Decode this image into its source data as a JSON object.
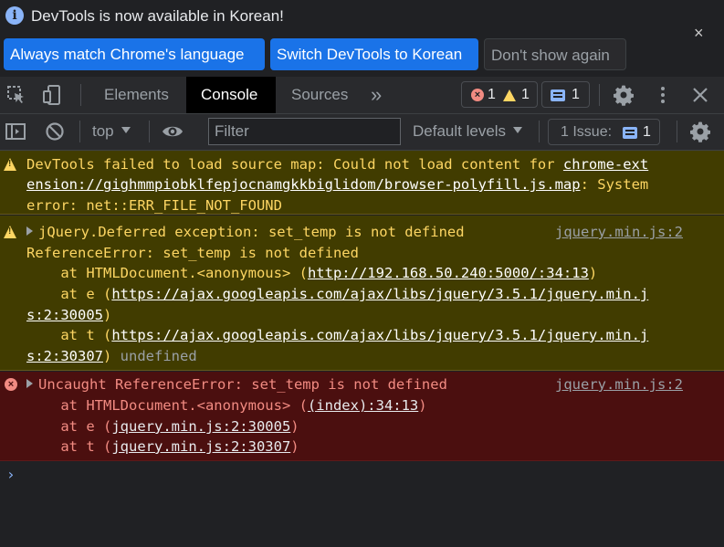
{
  "infobar": {
    "message": "DevTools is now available in Korean!",
    "always_match_label": "Always match Chrome's language",
    "switch_label": "Switch DevTools to Korean",
    "dont_show_label": "Don't show again",
    "close_glyph": "×"
  },
  "toolbar": {
    "tabs": [
      {
        "label": "Elements"
      },
      {
        "label": "Console"
      },
      {
        "label": "Sources"
      }
    ],
    "more_tabs_glyph": "»",
    "error_count": "1",
    "warning_count": "1",
    "message_count": "1"
  },
  "filterbar": {
    "context": "top",
    "filter_placeholder": "Filter",
    "levels": "Default levels",
    "issues_label": "1 Issue:",
    "issues_count": "1"
  },
  "console": {
    "messages": [
      {
        "level": "warning",
        "lines": {
          "l1_text": "DevTools failed to load source map: Could not load content for ",
          "l1_link": "chrome-ext",
          "l2_link": "ension://gighmmpiobklfepjocnamgkkbiglidom/browser-polyfill.js.map",
          "l2_text": ": System",
          "l3_text": "error: net::ERR_FILE_NOT_FOUND"
        }
      },
      {
        "level": "warning",
        "source": "jquery.min.js:2",
        "lines": {
          "l1": "jQuery.Deferred exception: set_temp is not defined",
          "l2": "ReferenceError: set_temp is not defined",
          "l3_pre": "    at HTMLDocument.<anonymous> (",
          "l3_link": "http://192.168.50.240:5000/:34:13",
          "l3_post": ")",
          "l4_pre": "    at e (",
          "l4_link": "https://ajax.googleapis.com/ajax/libs/jquery/3.5.1/jquery.min.j",
          "l5_link": "s:2:30005",
          "l5_post": ")",
          "l6_pre": "    at t (",
          "l6_link": "https://ajax.googleapis.com/ajax/libs/jquery/3.5.1/jquery.min.j",
          "l7_link": "s:2:30307",
          "l7_post": ")",
          "l7_muted": " undefined"
        }
      },
      {
        "level": "error",
        "source": "jquery.min.js:2",
        "lines": {
          "l1": "Uncaught ReferenceError: set_temp is not defined",
          "l2_pre": "    at HTMLDocument.<anonymous> (",
          "l2_link": "(index):34:13",
          "l2_post": ")",
          "l3_pre": "    at e (",
          "l3_link": "jquery.min.js:2:30005",
          "l3_post": ")",
          "l4_pre": "    at t (",
          "l4_link": "jquery.min.js:2:30307",
          "l4_post": ")"
        }
      }
    ],
    "prompt_glyph": "›"
  },
  "colors": {
    "accent": "#1a73e8",
    "warning_bg": "#413c00",
    "warning_text": "#fdd663",
    "error_bg": "#4b0f0f",
    "error_text": "#f28b82"
  }
}
